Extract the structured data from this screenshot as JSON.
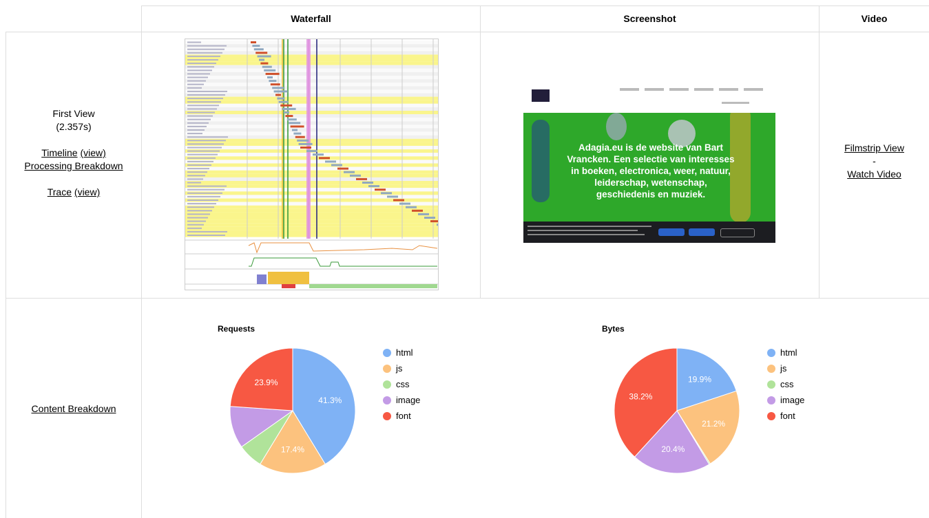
{
  "headers": {
    "waterfall": "Waterfall",
    "screenshot": "Screenshot",
    "video": "Video"
  },
  "first_view": {
    "label": "First View",
    "time": "(2.357s)",
    "timeline": "Timeline",
    "timeline_view": "(view)",
    "processing": "Processing Breakdown",
    "trace": "Trace",
    "trace_view": "(view)"
  },
  "video_links": {
    "filmstrip": "Filmstrip View",
    "separator": "-",
    "watch": "Watch Video"
  },
  "screenshot": {
    "headline": "Adagia.eu is de website van Bart Vrancken. Een selectie van interesses in boeken, electronica, weer, natuur, leiderschap, wetenschap, geschiedenis en muziek.",
    "colors": {
      "bg": "#2ea82a",
      "nav": "#ffffff",
      "cookie": "#1c1d21"
    }
  },
  "content_breakdown": "Content Breakdown",
  "legend": [
    "html",
    "js",
    "css",
    "image",
    "font"
  ],
  "colors": {
    "html": "#7fb2f5",
    "js": "#fcc27e",
    "css": "#b0e39a",
    "image": "#c39be6",
    "font": "#f75843"
  },
  "chart_data": [
    {
      "type": "pie",
      "title": "Requests",
      "labels": [
        "html",
        "js",
        "css",
        "image",
        "font"
      ],
      "values": [
        41.3,
        17.4,
        6.5,
        10.9,
        23.9
      ],
      "shown_labels": [
        "41.3%",
        "17.4%",
        "",
        "",
        "23.9%"
      ]
    },
    {
      "type": "pie",
      "title": "Bytes",
      "labels": [
        "html",
        "js",
        "css",
        "image",
        "font"
      ],
      "values": [
        19.9,
        21.2,
        0.3,
        20.4,
        38.2
      ],
      "shown_labels": [
        "19.9%",
        "21.2%",
        "",
        "20.4%",
        "38.2%"
      ]
    }
  ]
}
